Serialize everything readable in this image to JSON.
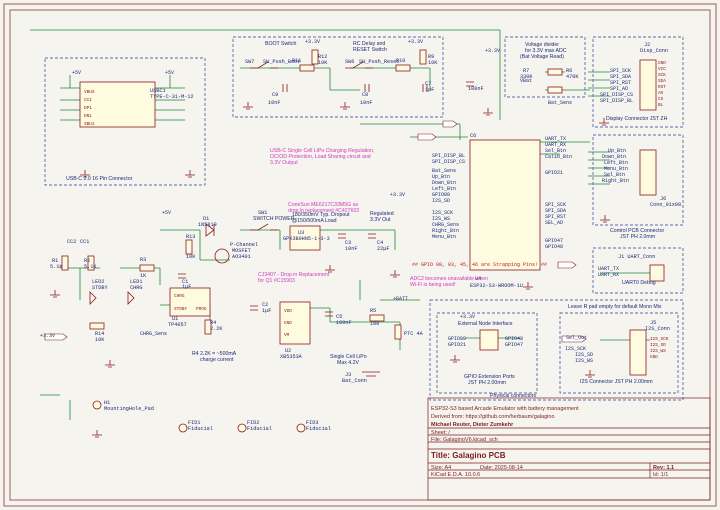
{
  "nets": {
    "plus5v": "+5V",
    "plus3v3": "+3.3V",
    "vbat": "VBat",
    "plus_bat": "+BATT"
  },
  "usb": {
    "ref": "USBC1",
    "part": "TYPE-C-31-M-12",
    "section_title": "USB-C 2.0 16 Pin Connector",
    "pins": [
      "VBUS",
      "CC1",
      "DP1",
      "DN1",
      "SBU1"
    ]
  },
  "boot": {
    "title": "BOOT Switch",
    "sw_ref": "SW7",
    "sw_part": "SW_Push_Boot",
    "r_ref": "R11",
    "r2_ref": "R12",
    "r2_val": "10K",
    "c_ref": "C9",
    "c_val": "10nF"
  },
  "reset": {
    "title": "RC Delay and",
    "title2": "RESET Switch",
    "sw_ref": "SW6",
    "sw_part": "SW_Push_Reset",
    "r_ref": "R10",
    "r2_ref": "R9",
    "r2_val": "10K",
    "c_ref": "C8",
    "c_val": "10nF",
    "c2_ref": "C7",
    "c2_val": "1µF"
  },
  "esp": {
    "c6_ref": "C6",
    "c6_val": "100nF",
    "ref": "U4",
    "part": "ESP32-S3-WROOM-1U",
    "left_nets": [
      "SPI_DISP_BL",
      "SPI_DISP_CS",
      "Bat_Sens",
      "Up_Btn",
      "Down_Btn",
      "Left_Btn",
      "GPIO08",
      "I2S_SD",
      "I2S_SCK",
      "I2S_WS",
      "CHRG_Sens",
      "Right_Btn",
      "Menu_Btn"
    ],
    "right_nets": [
      "UART_TX",
      "UART_RX",
      "Sel_Btn",
      "Calib_Btn",
      "GPIO21",
      "SPI_SCK",
      "SPI_SDA",
      "SPI_RST",
      "SEL_AD",
      "GPIO47",
      "GPIO48"
    ],
    "warning": "## GPIO 00, 03, 45, 46 are Strapping Pins! ##",
    "note1": "ADC2 becomes unavailable when",
    "note2": "Wi-Fi is being used!"
  },
  "vdiv": {
    "title1": "Voltage divider",
    "title2": "for 3.3V max ADC",
    "title3": "(Bat Voltage Read)",
    "r1_ref": "R7",
    "r1_val": "330K",
    "r2_ref": "R6",
    "r2_val": "470K",
    "net": "Bat_Sens"
  },
  "display": {
    "ref": "J2",
    "part": "Disp_Conn",
    "nets": [
      "SPI_SCK",
      "SPI_SDA",
      "SPI_RST",
      "SPI_AD",
      "SPI_DISP_CS",
      "SPI_DISP_BL"
    ],
    "pins": [
      "GND",
      "VCC",
      "SCK",
      "SDA",
      "RST",
      "AO",
      "CS",
      "BL"
    ],
    "section_title": "Display Connector JST ZH"
  },
  "control": {
    "nets": [
      "Up_Btn",
      "Down_Btn",
      "Left_Btn",
      "Menu_Btn",
      "Sel_Btn",
      "Right_Btn"
    ],
    "ref": "J6",
    "part": "Conn_01x08",
    "title1": "Control PCB Connector",
    "title2": "JST PH 2.0mm"
  },
  "uart": {
    "ref": "J1 UART_Conn",
    "nets": [
      "UART_TX",
      "UART_RX"
    ],
    "title": "UART0 Debug"
  },
  "gpio": {
    "title": "External Node Interface",
    "nets": [
      "GPIO08",
      "GPIO21",
      "GPIO48",
      "GPIO47"
    ],
    "sub1": "GPIO Extension Ports",
    "sub2": "JST PH 2.00mm"
  },
  "i2s": {
    "note": "Leave R pad empty for default Mono Mix",
    "nets": [
      "I2S_SCK",
      "I2S_SD",
      "I2S_WS"
    ],
    "flag": "Sel_Out",
    "ref": "J5",
    "part": "I2S_Conn",
    "pins": [
      "I2S_SCK",
      "I2S_SD",
      "I2S_WS",
      "GND"
    ],
    "title": "I2S Connector JST PH 2.00mm"
  },
  "physical": {
    "title": "Physical connectors"
  },
  "power": {
    "note1": "USB-C Single Cell LiPo Charging Regulation,",
    "note2": "OC/OD Protection, Load Sharing circuit and",
    "note3": "3.3V Output",
    "note4": "",
    "cone1": "ConeSun ME6217C33M5G as",
    "cone2": "drop in replacement #C427602",
    "ldo1": "180/350mV Typ. Dropout",
    "ldo2": "@150/500mA Load",
    "u3_ref": "U3",
    "u3_part": "GPX3B0HN5-1-3-3",
    "reg1": "Regulated",
    "reg2": "3.3V Out",
    "c3_ref": "C3",
    "c3_val": "10nF",
    "c4_ref": "C4",
    "c4_val": "22µF",
    "sw_title": "SWITCH POWER",
    "sw_ref": "SW1",
    "d1_ref": "D1",
    "d1_part": "1N5819",
    "q1_type": "P-Channel",
    "q1_mosfet": "MOSFET",
    "q1_part": "AO3401",
    "cj1": "CJ3407 - Drop in Replacement",
    "cj2": "for Q1 #C15903",
    "r13_ref": "R13",
    "r13_val": "10K",
    "r3_ref": "R3",
    "r3_val": "1K",
    "c1_ref": "C1",
    "c1_val": "1µF",
    "u1_ref": "U1",
    "u1_part": "TP4057",
    "u1_pins": [
      "CHRG",
      "STDBY",
      "PROG"
    ],
    "c2_ref": "C2",
    "c2_val": "1µF",
    "r4_ref": "R4",
    "r4_val": "2.2K",
    "r4_note1": "R4 2.2K = ~500mA",
    "r4_note2": "charge current",
    "led2_ref": "LED2",
    "led2_label": "STDBY",
    "led1_ref": "LED1",
    "led1_label": "CHRG",
    "r1_ref": "R1",
    "r1_val": "5.1K",
    "r2_ref": "R2",
    "r2_val": "5.1K",
    "r14_ref": "R14",
    "r14_val": "10K",
    "chrg_net": "CHRG_Sens",
    "cc1": "CC2",
    "cc2": "CC1"
  },
  "prot": {
    "pins": [
      "VDD",
      "GND",
      "VM"
    ],
    "ref": "U2",
    "part": "XB5353A",
    "c5_ref": "C5",
    "c5_val": "100nF",
    "r5_ref": "R5",
    "r5_val": "100",
    "ptc": "PTC 4A",
    "cell1": "Single Cell LiPo",
    "cell2": "Max 4.2V",
    "j_ref": "J3",
    "j_label": "Bat_Conn"
  },
  "mech": {
    "h1_ref": "H1",
    "h1_label": "MountingHole_Pad",
    "fid1_ref": "FID1",
    "fid2_ref": "FID2",
    "fid3_ref": "FID3",
    "fid_label": "Fiducial"
  },
  "titleblock": {
    "description": "ESP32-S3 based Arcade Emulator with battery management",
    "derived": "Derived from: https://github.com/herbaum/galagino",
    "authors": "Michael Reuter, Dieter Zumkehr",
    "sheet": "Sheet: /",
    "file": "File: GalaginoV6.kicad_sch",
    "title": "Title: Galagino PCB",
    "size": "Size: A4",
    "date": "Date: 2025-08-14",
    "rev": "Rev: 1.1",
    "kicad": "KiCad E.D.A. 10.0.6",
    "id": "Id: 1/1"
  }
}
